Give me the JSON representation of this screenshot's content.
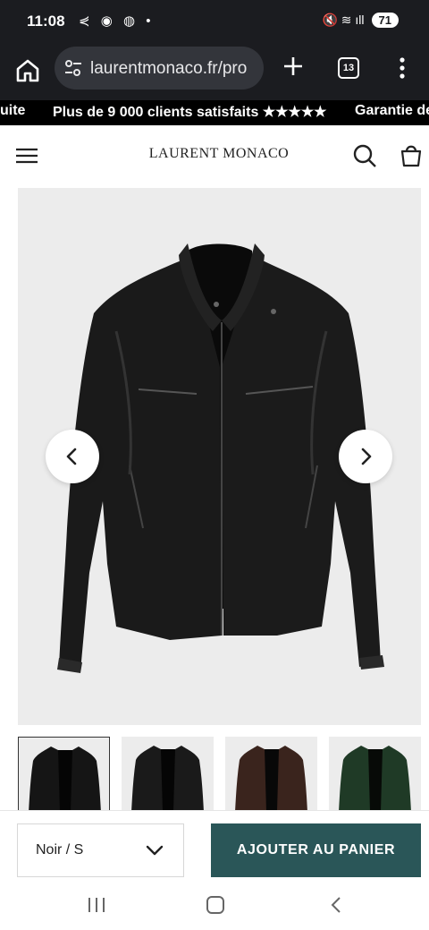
{
  "status_bar": {
    "time": "11:08",
    "left_icons": "⋞ ◉ ◍ •",
    "right_icons": "🔇 ≋ ıll",
    "battery": "71"
  },
  "browser": {
    "url": "laurentmonaco.fr/pro",
    "tab_count": "13"
  },
  "announcement": {
    "items": [
      "uite",
      "Plus de 9 000 clients satisfaits ★★★★★",
      "Garantie de"
    ]
  },
  "header": {
    "brand": "LAURENT MONACO"
  },
  "product": {
    "main_image_alt": "black-leather-jacket",
    "thumbnails": [
      {
        "color": "#151515"
      },
      {
        "color": "#1a1a1a"
      },
      {
        "color": "#3a241d"
      },
      {
        "color": "#1f3a26"
      }
    ]
  },
  "action_bar": {
    "variant_value": "Noir / S",
    "add_to_cart_label": "AJOUTER AU PANIER",
    "accent_color": "#2a5658"
  },
  "icons": {
    "home": "home-icon",
    "tune": "site-info-icon",
    "plus": "new-tab-icon",
    "menu": "more-vert-icon",
    "hamburger": "hamburger-menu-icon",
    "search": "search-icon",
    "bag": "shopping-bag-icon",
    "prev": "chevron-left-icon",
    "next": "chevron-right-icon",
    "chev_down": "chevron-down-icon"
  }
}
